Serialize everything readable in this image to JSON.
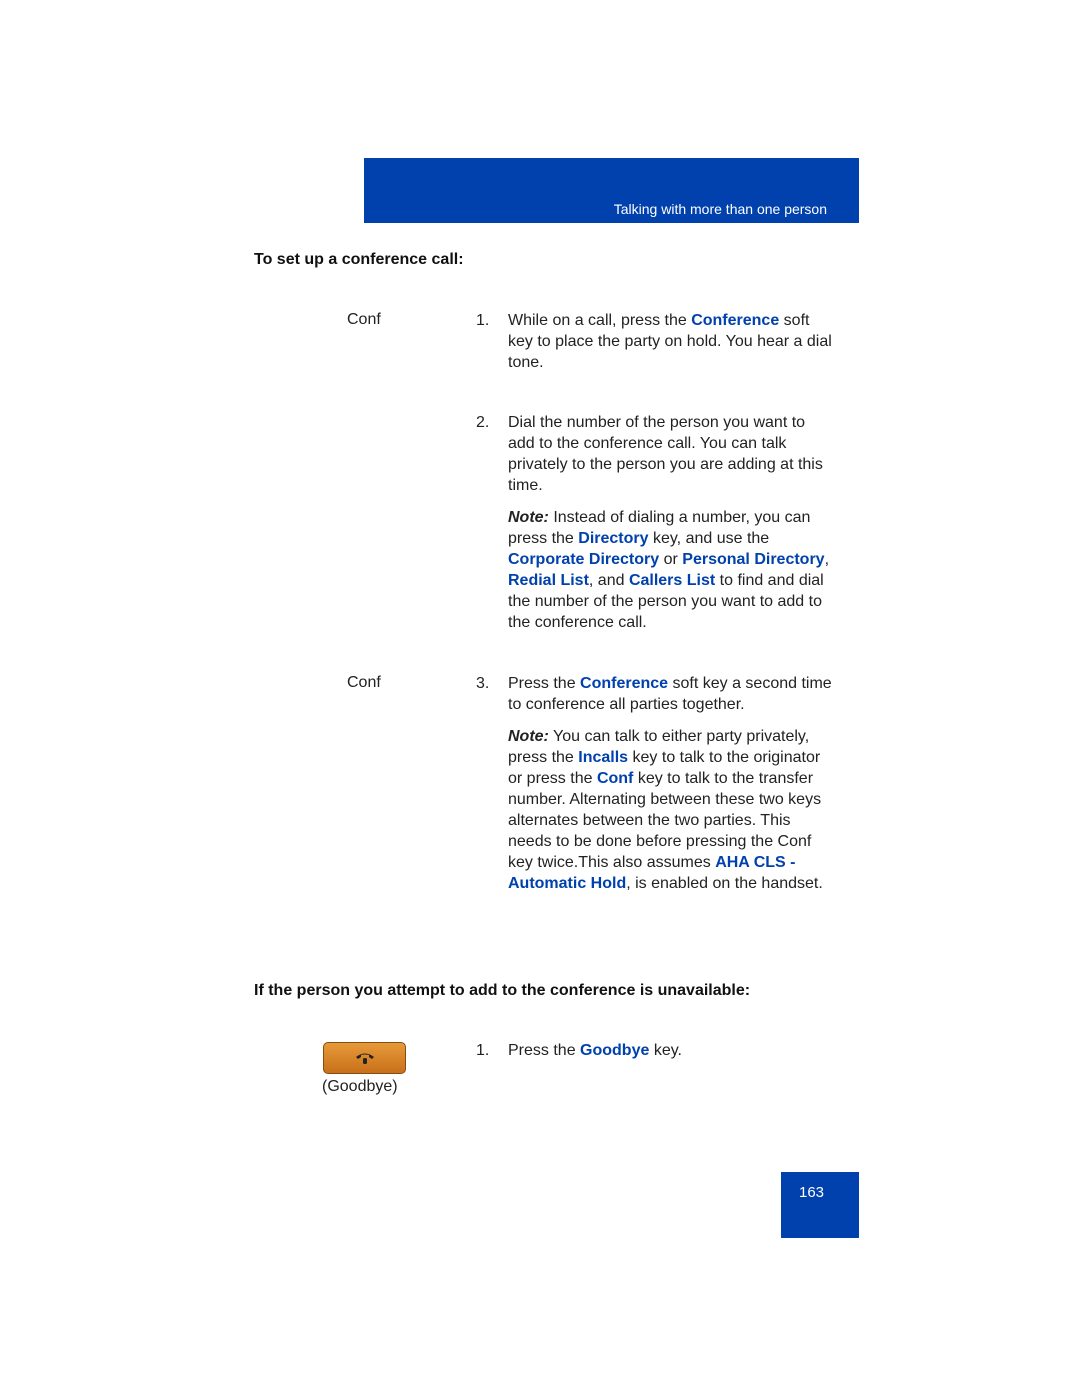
{
  "header": {
    "title": "Talking with more than one person"
  },
  "section1": {
    "heading": "To set up a conference call:",
    "steps": [
      {
        "key_label": "Conf",
        "num": "1.",
        "parts": [
          "While on a call, press the ",
          "Conference",
          " soft key to place the party on hold. You hear a dial tone."
        ]
      },
      {
        "key_label": "",
        "num": "2.",
        "text": "Dial the number of the person you want to add to the conference call. You can talk privately to the person you are adding at this time."
      },
      {
        "key_label": "Conf",
        "num": "3.",
        "parts": [
          "Press the ",
          "Conference",
          " soft key a second time to conference all parties together."
        ]
      }
    ],
    "note1": {
      "label": "Note:",
      "parts": [
        " Instead of dialing a number, you can press the ",
        "Directory",
        " key, and use the ",
        "Corporate Directory",
        " or ",
        "Personal Directory",
        ", ",
        "Redial List",
        ", and ",
        "Callers List",
        " to find and dial the number of the person you want to add to the conference call."
      ]
    },
    "note2": {
      "label": "Note:",
      "parts": [
        " You can talk to either party privately, press the ",
        "Incalls",
        " key to talk to the originator or press the ",
        "Conf",
        " key to talk to the transfer number. Alternating between these two keys alternates between the two parties. This needs to be done before pressing the Conf key twice.This also assumes ",
        "AHA CLS - Automatic Hold",
        ", is enabled on the handset."
      ]
    }
  },
  "section2": {
    "heading": "If the person you attempt to add to the conference is unavailable:",
    "key_label": "(Goodbye)",
    "key_icon": "handset-hangup-icon",
    "step": {
      "num": "1.",
      "parts": [
        "Press the ",
        "Goodbye",
        " key."
      ]
    }
  },
  "footer": {
    "page_number": "163"
  },
  "colors": {
    "brand_blue": "#0041ad",
    "key_orange": "#d9852a"
  }
}
